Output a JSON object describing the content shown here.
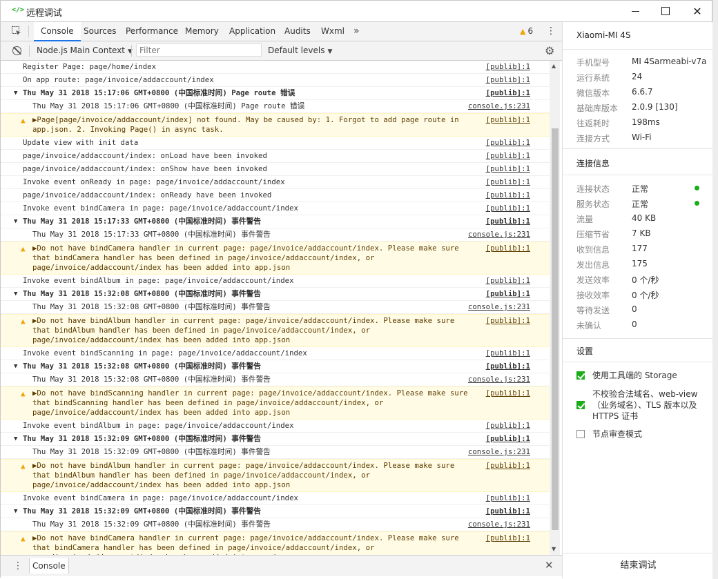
{
  "window": {
    "icon": "</>",
    "title": "远程调试"
  },
  "tabs": {
    "items": [
      "Console",
      "Sources",
      "Performance",
      "Memory",
      "Application",
      "Audits",
      "Wxml"
    ],
    "more": "»",
    "warning_count": "6"
  },
  "toolbar": {
    "context": "Node.js Main Context",
    "filter_placeholder": "Filter",
    "levels": "Default levels"
  },
  "console": {
    "rows": [
      {
        "type": "log",
        "text": "Register Page: page/home/index",
        "src": "[publib]:1"
      },
      {
        "type": "log",
        "text": "On app route: page/invoice/addaccount/index",
        "src": "[publib]:1"
      },
      {
        "type": "group",
        "text": "Thu May 31 2018 15:17:06 GMT+0800 (中国标准时间) Page route 错误",
        "src": "[publib]:1"
      },
      {
        "type": "sub",
        "text": "Thu May 31 2018 15:17:06 GMT+0800 (中国标准时间) Page route 错误",
        "src": "console.js:231"
      },
      {
        "type": "warn",
        "text": "▶Page[page/invoice/addaccount/index] not found. May be caused by: 1. Forgot to add page route in app.json. 2. Invoking Page() in async task.",
        "src": "[publib]:1"
      },
      {
        "type": "log",
        "text": "Update view with init data",
        "src": "[publib]:1"
      },
      {
        "type": "log",
        "text": "page/invoice/addaccount/index: onLoad have been invoked",
        "src": "[publib]:1"
      },
      {
        "type": "log",
        "text": "page/invoice/addaccount/index: onShow have been invoked",
        "src": "[publib]:1"
      },
      {
        "type": "log",
        "text": "Invoke event onReady in page: page/invoice/addaccount/index",
        "src": "[publib]:1"
      },
      {
        "type": "log",
        "text": "page/invoice/addaccount/index: onReady have been invoked",
        "src": "[publib]:1"
      },
      {
        "type": "log",
        "text": "Invoke event bindCamera in page: page/invoice/addaccount/index",
        "src": "[publib]:1"
      },
      {
        "type": "group",
        "text": "Thu May 31 2018 15:17:33 GMT+0800 (中国标准时间) 事件警告",
        "src": "[publib]:1"
      },
      {
        "type": "sub",
        "text": "Thu May 31 2018 15:17:33 GMT+0800 (中国标准时间) 事件警告",
        "src": "console.js:231"
      },
      {
        "type": "warn",
        "text": "▶Do not have bindCamera handler in current page: page/invoice/addaccount/index. Please make sure that bindCamera handler has been defined in page/invoice/addaccount/index, or page/invoice/addaccount/index has been added into app.json",
        "src": "[publib]:1"
      },
      {
        "type": "log",
        "text": "Invoke event bindAlbum in page: page/invoice/addaccount/index",
        "src": "[publib]:1"
      },
      {
        "type": "group",
        "text": "Thu May 31 2018 15:32:08 GMT+0800 (中国标准时间) 事件警告",
        "src": "[publib]:1"
      },
      {
        "type": "sub",
        "text": "Thu May 31 2018 15:32:08 GMT+0800 (中国标准时间) 事件警告",
        "src": "console.js:231"
      },
      {
        "type": "warn",
        "text": "▶Do not have bindAlbum handler in current page: page/invoice/addaccount/index. Please make sure that bindAlbum handler has been defined in page/invoice/addaccount/index, or page/invoice/addaccount/index has been added into app.json",
        "src": "[publib]:1"
      },
      {
        "type": "log",
        "text": "Invoke event bindScanning in page: page/invoice/addaccount/index",
        "src": "[publib]:1"
      },
      {
        "type": "group",
        "text": "Thu May 31 2018 15:32:08 GMT+0800 (中国标准时间) 事件警告",
        "src": "[publib]:1"
      },
      {
        "type": "sub",
        "text": "Thu May 31 2018 15:32:08 GMT+0800 (中国标准时间) 事件警告",
        "src": "console.js:231"
      },
      {
        "type": "warn",
        "text": "▶Do not have bindScanning handler in current page: page/invoice/addaccount/index. Please make sure that bindScanning handler has been defined in page/invoice/addaccount/index, or page/invoice/addaccount/index has been added into app.json",
        "src": "[publib]:1"
      },
      {
        "type": "log",
        "text": "Invoke event bindAlbum in page: page/invoice/addaccount/index",
        "src": "[publib]:1"
      },
      {
        "type": "group",
        "text": "Thu May 31 2018 15:32:09 GMT+0800 (中国标准时间) 事件警告",
        "src": "[publib]:1"
      },
      {
        "type": "sub",
        "text": "Thu May 31 2018 15:32:09 GMT+0800 (中国标准时间) 事件警告",
        "src": "console.js:231"
      },
      {
        "type": "warn",
        "text": "▶Do not have bindAlbum handler in current page: page/invoice/addaccount/index. Please make sure that bindAlbum handler has been defined in page/invoice/addaccount/index, or page/invoice/addaccount/index has been added into app.json",
        "src": "[publib]:1"
      },
      {
        "type": "log",
        "text": "Invoke event bindCamera in page: page/invoice/addaccount/index",
        "src": "[publib]:1"
      },
      {
        "type": "group",
        "text": "Thu May 31 2018 15:32:09 GMT+0800 (中国标准时间) 事件警告",
        "src": "[publib]:1"
      },
      {
        "type": "sub",
        "text": "Thu May 31 2018 15:32:09 GMT+0800 (中国标准时间) 事件警告",
        "src": "console.js:231"
      },
      {
        "type": "warn",
        "text": "▶Do not have bindCamera handler in current page: page/invoice/addaccount/index. Please make sure that bindCamera handler has been defined in page/invoice/addaccount/index, or page/invoice/addaccount/index has been added into app.json",
        "src": "[publib]:1"
      }
    ]
  },
  "drawer": {
    "tab": "Console"
  },
  "panel": {
    "device": "Xiaomi-MI 4S",
    "device_info": [
      {
        "k": "手机型号",
        "v": "MI 4Sarmeabi-v7a"
      },
      {
        "k": "运行系统",
        "v": "24"
      },
      {
        "k": "微信版本",
        "v": "6.6.7"
      },
      {
        "k": "基础库版本",
        "v": "2.0.9 [130]"
      },
      {
        "k": "往返耗时",
        "v": "198ms"
      },
      {
        "k": "连接方式",
        "v": "Wi-Fi"
      }
    ],
    "conn_heading": "连接信息",
    "conn_info": [
      {
        "k": "连接状态",
        "v": "正常",
        "dot": true
      },
      {
        "k": "服务状态",
        "v": "正常",
        "dot": true
      },
      {
        "k": "流量",
        "v": "40 KB"
      },
      {
        "k": "压缩节省",
        "v": "7 KB"
      },
      {
        "k": "收到信息",
        "v": "177"
      },
      {
        "k": "发出信息",
        "v": "175"
      },
      {
        "k": "发送效率",
        "v": "0 个/秒"
      },
      {
        "k": "接收效率",
        "v": "0 个/秒"
      },
      {
        "k": "等待发送",
        "v": "0"
      },
      {
        "k": "未确认",
        "v": "0"
      }
    ],
    "settings_heading": "设置",
    "settings": [
      {
        "label": "使用工具端的 Storage",
        "checked": true
      },
      {
        "label": "不校验合法域名、web-view（业务域名）、TLS 版本以及 HTTPS 证书",
        "checked": true
      },
      {
        "label": "节点审查模式",
        "checked": false
      }
    ],
    "end_button": "结束调试",
    "status_color": "#1aad19"
  }
}
